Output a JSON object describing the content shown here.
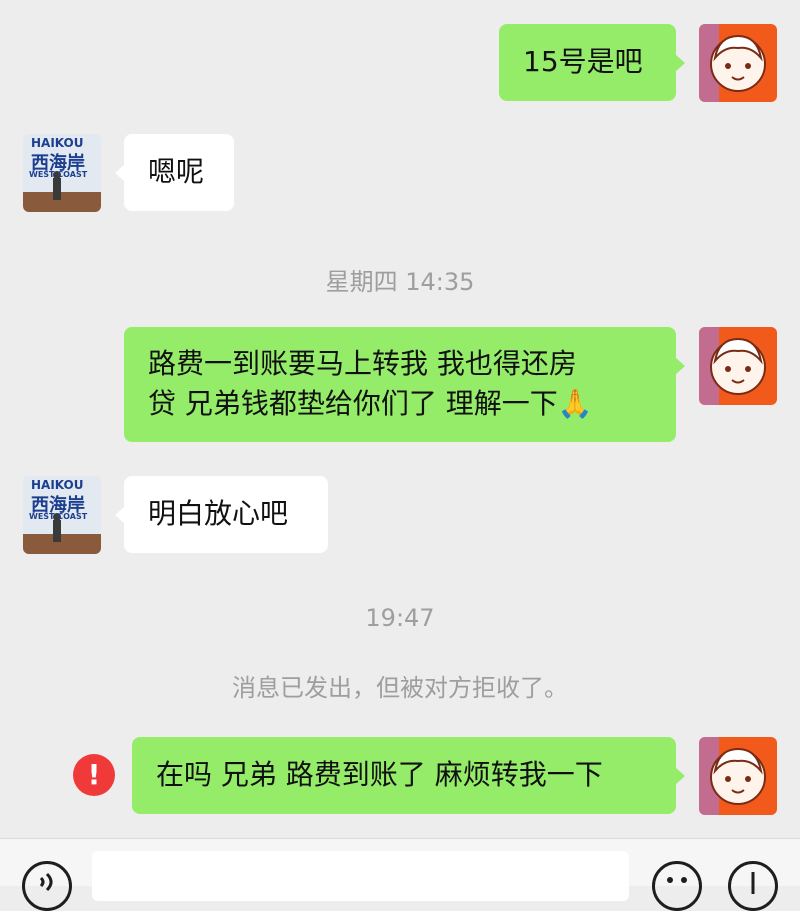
{
  "colors": {
    "background": "#ededed",
    "my_bubble": "#95ec69",
    "their_bubble": "#ffffff",
    "error": "#f03a3a",
    "timestamp_text": "#9e9e9e"
  },
  "messages": [
    {
      "sender": "me",
      "text": "15号是吧"
    },
    {
      "sender": "friend",
      "text": "嗯呢"
    },
    {
      "type": "timestamp",
      "text": "星期四 14:35"
    },
    {
      "sender": "me",
      "line1": "路费一到账要马上转我 我也得还房",
      "line2": "贷 兄弟钱都垫给你们了  理解一下🙏"
    },
    {
      "sender": "friend",
      "text": "明白放心吧"
    },
    {
      "type": "timestamp",
      "text": "19:47"
    },
    {
      "type": "system",
      "text": "消息已发出，但被对方拒收了。"
    },
    {
      "sender": "me",
      "text": "在吗 兄弟 路费到账了 麻烦转我一下",
      "status": "failed"
    }
  ],
  "friend_avatar": {
    "line1": "HAIKOU",
    "line2": "西海岸",
    "line3": "WEST COAST"
  },
  "error_symbol": "!",
  "icons": {
    "my_avatar": "cartoon-face-avatar",
    "friend_avatar": "photo-avatar",
    "failed_status": "exclamation-circle-icon",
    "voice": "voice-icon",
    "emoji": "emoji-icon",
    "more": "plus-icon"
  }
}
